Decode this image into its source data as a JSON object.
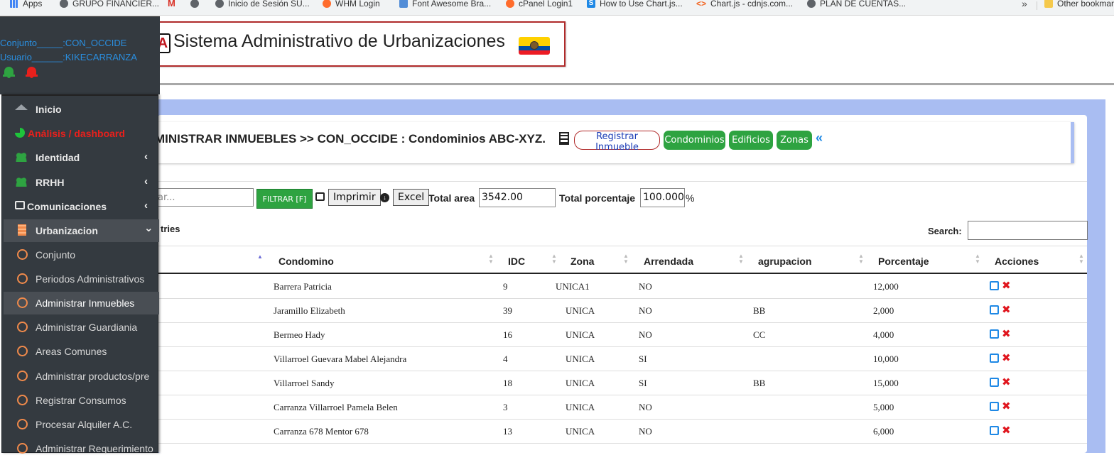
{
  "bookmarks": {
    "items": [
      {
        "label": "Apps",
        "icon": "apps-grid-icon"
      },
      {
        "label": "GRUPO FINANCIER...",
        "icon": "globe-icon"
      },
      {
        "label": "",
        "icon": "gmail-icon"
      },
      {
        "label": "",
        "icon": "globe-icon"
      },
      {
        "label": "Inicio de Sesión SU...",
        "icon": "globe-icon"
      },
      {
        "label": "WHM Login",
        "icon": "cpanel-icon"
      },
      {
        "label": "Font Awesome Bra...",
        "icon": "fontawesome-icon"
      },
      {
        "label": "cPanel Login1",
        "icon": "cpanel-icon"
      },
      {
        "label": "How to Use Chart.js...",
        "icon": "s-icon"
      },
      {
        "label": "Chart.js - cdnjs.com...",
        "icon": "code-icon"
      },
      {
        "label": "PLAN DE CUENTAS...",
        "icon": "globe-icon"
      }
    ],
    "more": "»",
    "other": "Other bookmarks"
  },
  "header": {
    "logo_letter": "A",
    "title": "Sistema Administrativo de Urbanizaciones"
  },
  "sidebar": {
    "conjunto": "Conjunto_____:CON_OCCIDE",
    "usuario": "Usuario______:KIKECARRANZA",
    "menu": [
      {
        "label": "Inicio"
      },
      {
        "label": "Análisis / dashboard"
      },
      {
        "label": "Identidad",
        "chevron": "‹"
      },
      {
        "label": "RRHH",
        "chevron": "‹"
      },
      {
        "label": "Comunicaciones",
        "chevron": "‹"
      },
      {
        "label": "Urbanizacion",
        "chevron": "⌄"
      }
    ],
    "submenu": [
      {
        "label": "Conjunto"
      },
      {
        "label": "Periodos Administrativos"
      },
      {
        "label": "Administrar Inmuebles"
      },
      {
        "label": "Administrar Guardiania"
      },
      {
        "label": "Areas Comunes"
      },
      {
        "label": "Administrar productos/pre"
      },
      {
        "label": "Registrar Consumos"
      },
      {
        "label": "Procesar Alquiler A.C."
      },
      {
        "label": "Administrar Requerimiento"
      }
    ],
    "colors": {
      "bg": "#343a40",
      "link": "#2a8fe0",
      "alert": "#e8201c",
      "ok": "#2ea341"
    }
  },
  "crumb": {
    "title": "MINISTRAR INMUEBLES >> CON_OCCIDE : Condominios ABC-XYZ.",
    "register_label": "Registrar Inmueble",
    "condominios_label": "Condominios",
    "edificios_label": "Edificios",
    "zonas_label": "Zonas",
    "back_label": "«"
  },
  "filters": {
    "search_placeholder": "ar...",
    "filter_label": "FILTRAR [F]",
    "print_label": "Imprimir",
    "excel_label": "Excel",
    "total_area_label": "Total area",
    "total_area_value": "3542.00",
    "total_pct_label": "Total porcentaje",
    "total_pct_value": "100.000",
    "pct_sign": "%",
    "entries_text": "tries",
    "search_label": "Search:"
  },
  "table": {
    "columns": [
      "Condomino",
      "IDC",
      "Zona",
      "Arrendada",
      "agrupacion",
      "Porcentaje",
      "Acciones"
    ],
    "rows": [
      {
        "condomino": "Barrera Patricia",
        "idc": "9",
        "zona": "UNICA1",
        "arrendada": "NO",
        "agrupacion": "",
        "porcentaje": "12,000"
      },
      {
        "condomino": "Jaramillo Elizabeth",
        "idc": "39",
        "zona": "UNICA",
        "arrendada": "NO",
        "agrupacion": "BB",
        "porcentaje": "2,000"
      },
      {
        "condomino": "Bermeo Hady",
        "idc": "16",
        "zona": "UNICA",
        "arrendada": "NO",
        "agrupacion": "CC",
        "porcentaje": "4,000"
      },
      {
        "condomino": "Villarroel Guevara Mabel Alejandra",
        "idc": "4",
        "zona": "UNICA",
        "arrendada": "SI",
        "agrupacion": "",
        "porcentaje": "10,000"
      },
      {
        "condomino": "Villarroel Sandy",
        "idc": "18",
        "zona": "UNICA",
        "arrendada": "SI",
        "agrupacion": "BB",
        "porcentaje": "15,000"
      },
      {
        "condomino": "Carranza Villarroel Pamela Belen",
        "idc": "3",
        "zona": "UNICA",
        "arrendada": "NO",
        "agrupacion": "",
        "porcentaje": "5,000"
      },
      {
        "condomino": "Carranza 678 Mentor 678",
        "idc": "13",
        "zona": "UNICA",
        "arrendada": "NO",
        "agrupacion": "",
        "porcentaje": "6,000"
      }
    ]
  }
}
